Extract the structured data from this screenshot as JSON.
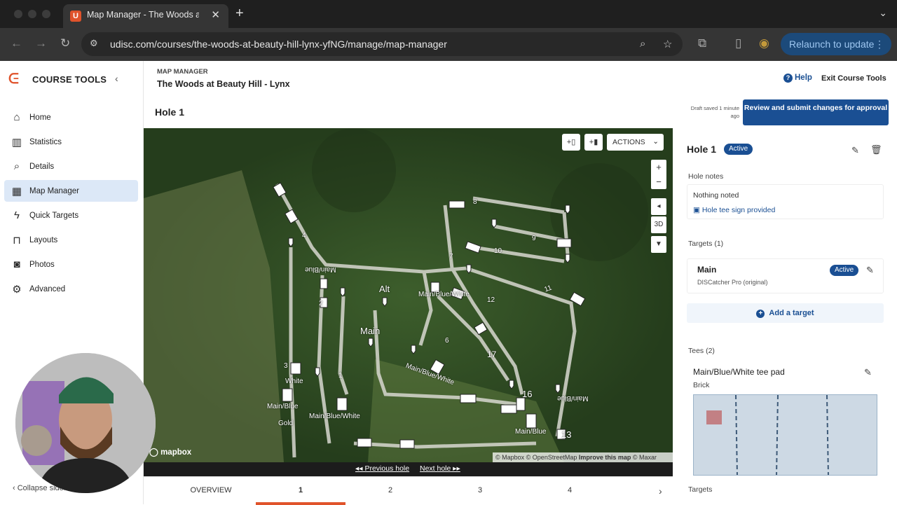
{
  "browser": {
    "tab_title": "Map Manager - The Woods at Beauty Hill - Lynx",
    "new_tab_icon": "plus-icon",
    "url": "udisc.com/courses/the-woods-at-beauty-hill-lynx-yfNG/manage/map-manager",
    "relaunch_label": "Relaunch to update"
  },
  "sidebar": {
    "brand": "COURSE TOOLS",
    "items": [
      {
        "label": "Home",
        "icon": "home-icon"
      },
      {
        "label": "Statistics",
        "icon": "bar-chart-icon"
      },
      {
        "label": "Details",
        "icon": "search-icon"
      },
      {
        "label": "Map Manager",
        "icon": "map-icon",
        "active": true
      },
      {
        "label": "Quick Targets",
        "icon": "bolt-icon"
      },
      {
        "label": "Layouts",
        "icon": "layouts-icon"
      },
      {
        "label": "Photos",
        "icon": "camera-icon"
      },
      {
        "label": "Advanced",
        "icon": "gear-icon"
      }
    ],
    "collapse_label": "Collapse sidebar"
  },
  "header": {
    "eyebrow": "MAP MANAGER",
    "course_title": "The Woods at Beauty Hill - Lynx",
    "help_label": "Help",
    "exit_label": "Exit Course Tools",
    "hole_heading": "Hole 1",
    "draft_status": "Draft saved 1 minute ago",
    "review_button": "Review and submit changes for approval"
  },
  "map": {
    "actions_label": "ACTIONS",
    "add_target_label": "+",
    "add_tee_label": "+",
    "zoom_in": "+",
    "zoom_out": "−",
    "three_d": "3D",
    "labels": [
      "Main",
      "Alt",
      "Main/Blue",
      "White",
      "Gold",
      "Main/Blue/White",
      "Main/Blue/White",
      "10",
      "11",
      "12",
      "13",
      "16",
      "17",
      "9",
      "8",
      "4",
      "3",
      "2",
      "1",
      "6",
      "7",
      "Main/Blue",
      "Main/Blue/White",
      "Main/Blue",
      "Main/Blue"
    ],
    "mapbox_label": "mapbox",
    "attribution": {
      "mapbox": "© Mapbox",
      "osm": "© OpenStreetMap",
      "improve": "Improve this map",
      "maxar": "© Maxar"
    },
    "prev_hole": "Previous hole",
    "next_hole": "Next hole"
  },
  "hole_tabs": [
    "OVERVIEW",
    "1",
    "2",
    "3",
    "4"
  ],
  "active_tab": "1",
  "panel": {
    "hole_title": "Hole 1",
    "status": "Active",
    "notes_label": "Hole notes",
    "notes_value": "Nothing noted",
    "tee_sign": "Hole tee sign provided",
    "targets_label": "Targets (1)",
    "target_name": "Main",
    "target_status": "Active",
    "target_type": "DISCatcher Pro (original)",
    "add_target": "Add a target",
    "tees_label": "Tees (2)",
    "tee_name": "Main/Blue/White tee pad",
    "tee_surface": "Brick",
    "tee_targets_label": "Targets"
  },
  "colors": {
    "accent": "#1a4f93",
    "brand": "#e0532b",
    "active_nav": "#dce8f7"
  }
}
